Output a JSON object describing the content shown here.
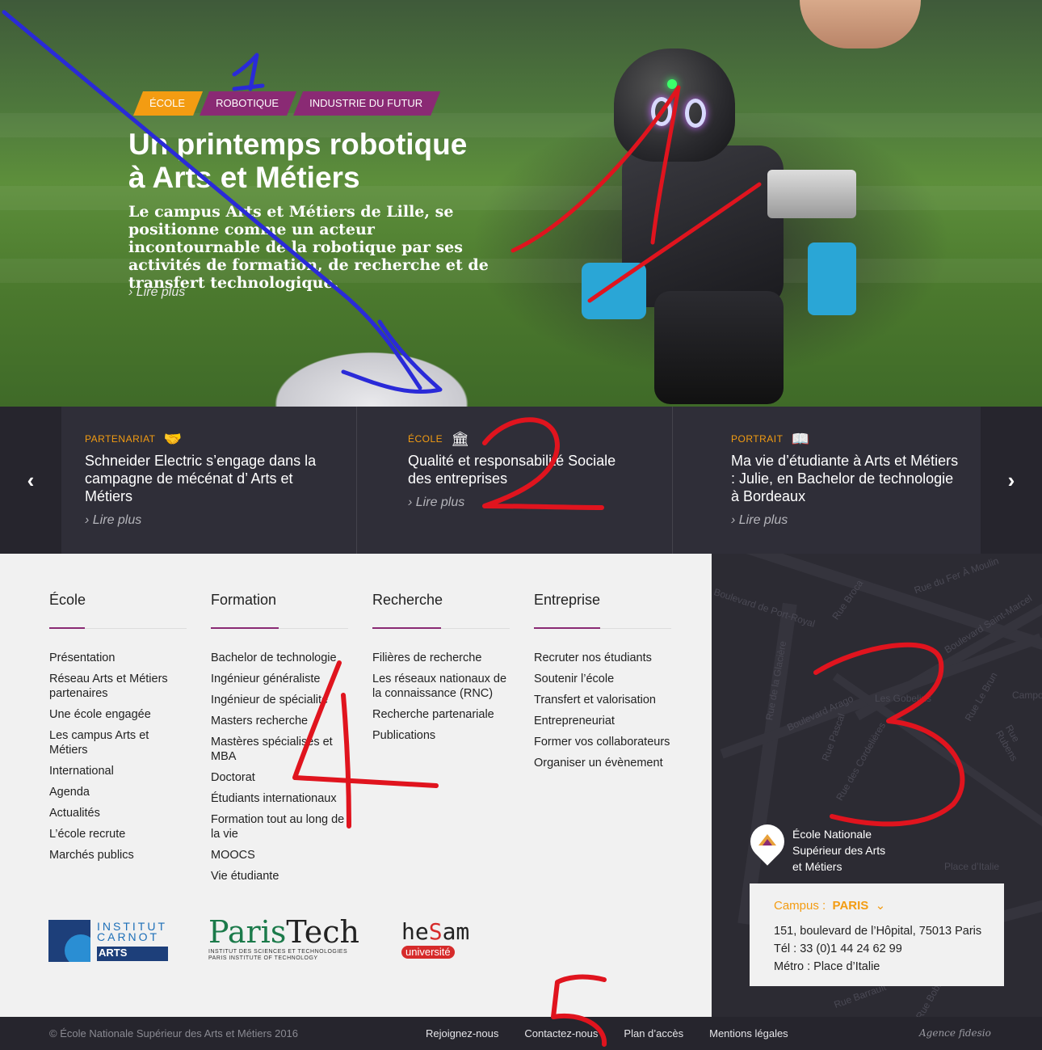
{
  "hero": {
    "tags": [
      {
        "label": "ÉCOLE",
        "color": "#f39c12"
      },
      {
        "label": "ROBOTIQUE",
        "color": "#8a2a74"
      },
      {
        "label": "INDUSTRIE DU FUTUR",
        "color": "#8a2a74"
      }
    ],
    "title_line1": "Un printemps robotique",
    "title_line2": "à Arts et Métiers",
    "text": "Le campus Arts et Métiers de Lille, se positionne comme un acteur incontournable de la robotique par ses activités de formation, de recherche et de transfert technologique.",
    "more": "Lire plus"
  },
  "news": {
    "items": [
      {
        "category": "PARTENARIAT",
        "icon": "handshake-icon",
        "title": "Schneider Electric s’engage dans la campagne de mécénat d’ Arts et Métiers",
        "more": "Lire plus"
      },
      {
        "category": "ÉCOLE",
        "icon": "building-icon",
        "title": "Qualité et responsabilité Sociale des entreprises",
        "more": "Lire plus"
      },
      {
        "category": "PORTRAIT",
        "icon": "book-icon",
        "title": "Ma vie d’étudiante à Arts et Métiers : Julie, en Bachelor de technologie à Bordeaux",
        "more": "Lire plus"
      }
    ]
  },
  "footer_nav": {
    "columns": [
      {
        "heading": "École",
        "links": [
          "Présentation",
          "Réseau Arts et Métiers partenaires",
          "Une école engagée",
          "Les campus Arts et Métiers",
          "International",
          "Agenda",
          "Actualités",
          "L’école recrute",
          "Marchés publics"
        ]
      },
      {
        "heading": "Formation",
        "links": [
          "Bachelor de technologie",
          "Ingénieur généraliste",
          "Ingénieur de spécialité",
          "Masters recherche",
          "Mastères spécialisés et MBA",
          "Doctorat",
          "Étudiants internationaux",
          "Formation tout au long de la vie",
          "MOOCS",
          "Vie étudiante"
        ]
      },
      {
        "heading": "Recherche",
        "links": [
          "Filières de recherche",
          "Les réseaux nationaux de la connaissance (RNC)",
          "Recherche partenariale",
          "Publications"
        ]
      },
      {
        "heading": "Entreprise",
        "links": [
          "Recruter nos étudiants",
          "Soutenir l’école",
          "Transfert et valorisation",
          "Entrepreneuriat",
          "Former vos collaborateurs",
          "Organiser un évènement"
        ]
      }
    ]
  },
  "logos": {
    "carnot_line1": "INSTITUT",
    "carnot_line2": "CARNOT",
    "carnot_line3": "ARTS",
    "paristech_a": "Paris",
    "paristech_b": "Tech",
    "paristech_sub1": "INSTITUT DES SCIENCES ET TECHNOLOGIES",
    "paristech_sub2": "PARIS INSTITUTE OF TECHNOLOGY",
    "hesam_a": "he",
    "hesam_b": "S",
    "hesam_c": "am",
    "hesam_pill": "université"
  },
  "map": {
    "pin_label": "École Nationale Supérieur des Arts et Métiers",
    "campus_label": "Campus :",
    "campus_value": "PARIS",
    "address": "151, boulevard de l’Hôpital, 75013 Paris",
    "phone": "Tél : 33 (0)1 44 24 62 99",
    "metro": "Métro : Place d’Italie",
    "street_labels": [
      "Boulevard de Port-Royal",
      "Rue Broca",
      "Rue du Fer À Moulin",
      "Boulevard Saint-Marcel",
      "Rue de la Glacière",
      "Boulevard Arago",
      "Rue Pascal",
      "Rue des Cordelières",
      "Les Gobelins",
      "Rue Le Brun",
      "Rue Rubens",
      "Campo",
      "Place d’Italie",
      "Rue Barrault",
      "Rue Bobillot"
    ]
  },
  "bottom": {
    "copyright": "© École Nationale Supérieur des Arts et Métiers 2016",
    "links": [
      "Rejoignez-nous",
      "Contactez-nous",
      "Plan d’accès",
      "Mentions légales"
    ],
    "agency": "Agence fidesio"
  },
  "annotations": {
    "labels": [
      "1",
      "1",
      "2",
      "3",
      "4",
      "5"
    ],
    "colors": {
      "red": "#e0141e",
      "blue": "#2a2ad8"
    }
  }
}
